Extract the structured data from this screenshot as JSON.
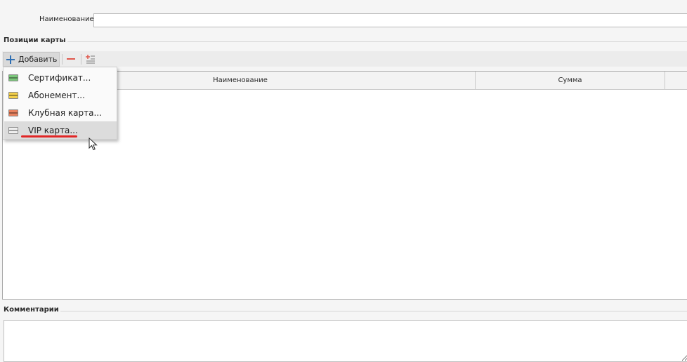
{
  "form": {
    "name_label": "Наименование:",
    "name_value": ""
  },
  "positions": {
    "title": "Позиции карты",
    "toolbar": {
      "add_label": "Добавить"
    },
    "grid": {
      "columns": [
        "",
        "Наименование",
        "Сумма",
        ""
      ]
    }
  },
  "add_menu": {
    "items": [
      {
        "label": "Сертификат...",
        "color": "#7bc67b"
      },
      {
        "label": "Абонемент...",
        "color": "#f2cf4a"
      },
      {
        "label": "Клубная карта...",
        "color": "#e8825f"
      },
      {
        "label": "VIP карта...",
        "color": "#d8d8d8"
      }
    ]
  },
  "comments": {
    "title": "Комментарии",
    "value": ""
  },
  "colors": {
    "accent": "#2f6fb3",
    "remove": "#e0584d",
    "highlight_mark": "#e12626"
  }
}
